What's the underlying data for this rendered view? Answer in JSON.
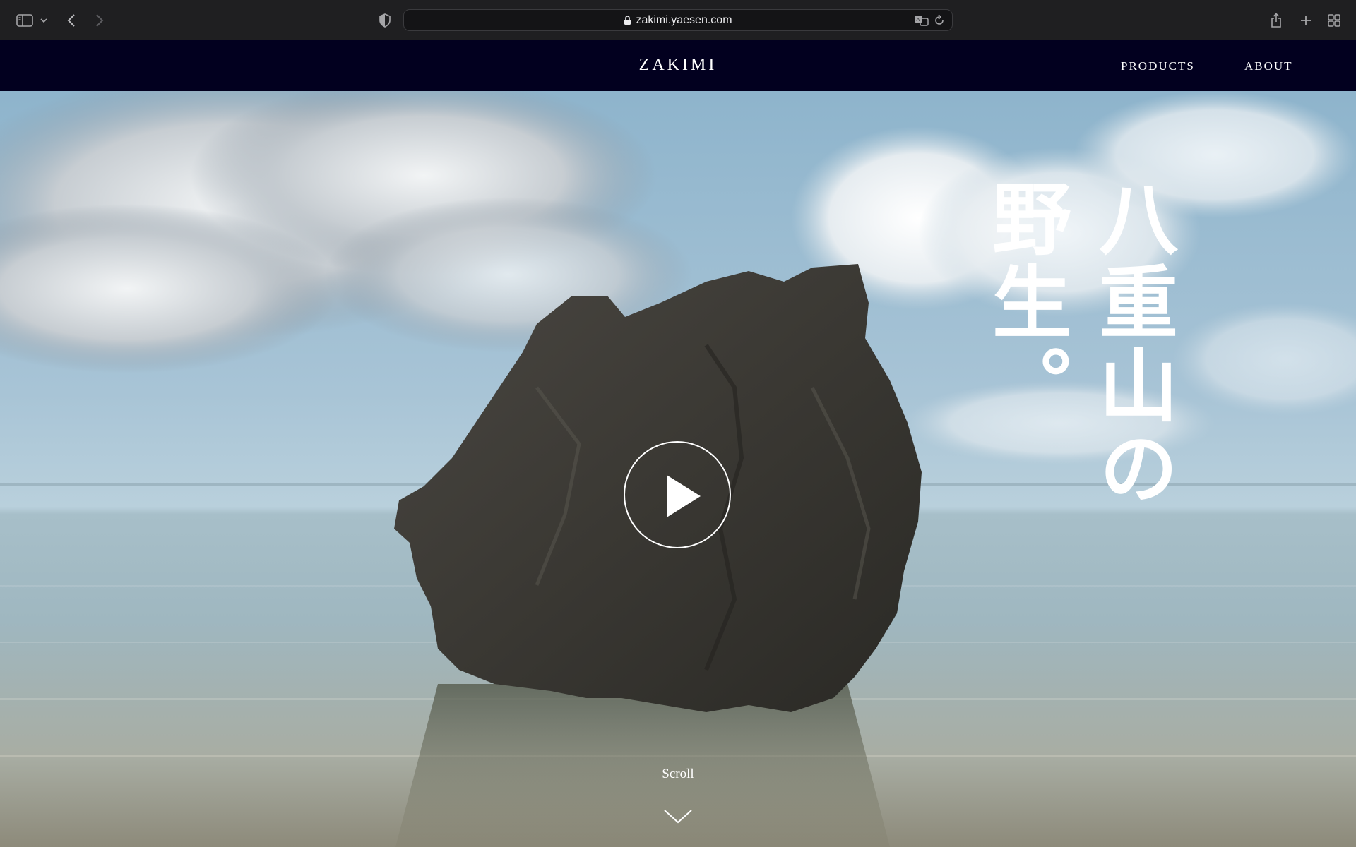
{
  "browser": {
    "url": "zakimi.yaesen.com"
  },
  "site": {
    "brand": "ZAKIMI",
    "nav": {
      "products": "PRODUCTS",
      "about": "ABOUT"
    }
  },
  "hero": {
    "tagline_right": "八重山の",
    "tagline_left": "野生。",
    "scroll_label": "Scroll"
  },
  "colors": {
    "chrome_bg": "#1f1f21",
    "nav_bg": "#02001f",
    "text": "#ffffff"
  },
  "icons": {
    "sidebar": "sidebar-icon",
    "back": "chevron-left-icon",
    "forward": "chevron-right-icon",
    "privacy": "shield-icon",
    "lock": "lock-icon",
    "translate": "translate-icon",
    "reload": "reload-icon",
    "share": "share-icon",
    "new_tab": "plus-icon",
    "tabs": "tab-overview-icon",
    "play": "play-icon",
    "scroll": "chevron-down-icon"
  }
}
